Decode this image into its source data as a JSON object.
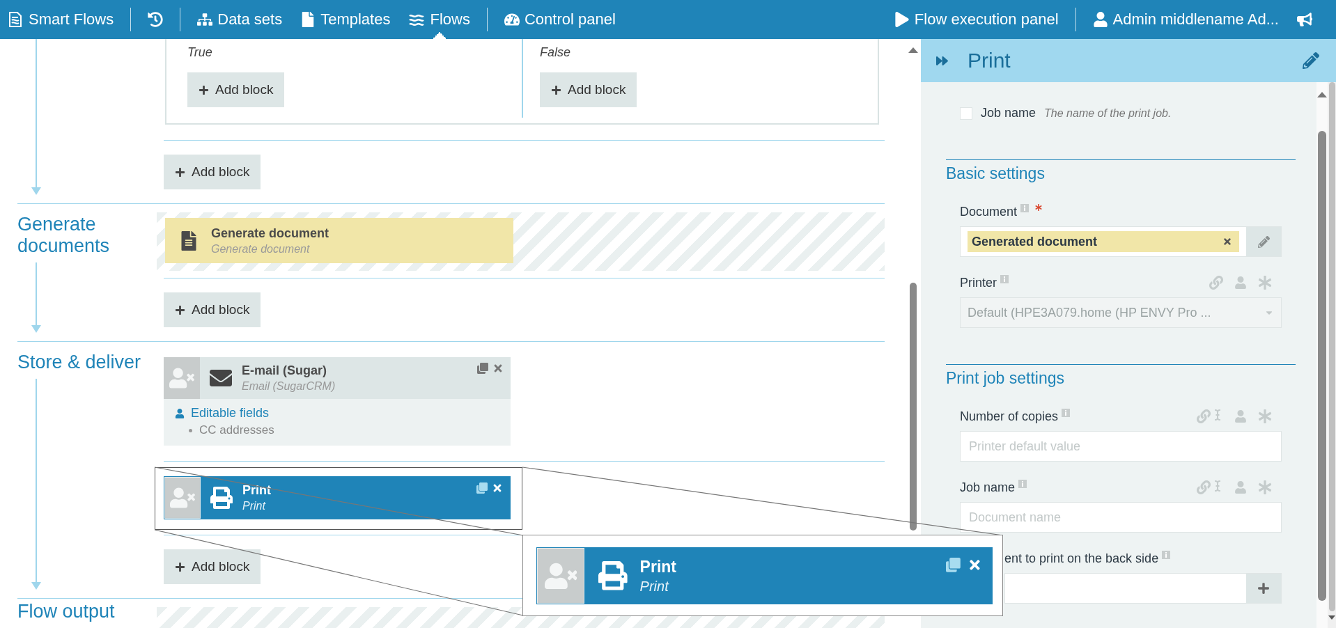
{
  "nav": {
    "left": [
      [
        {
          "kind": "brand",
          "label": "Smart Flows"
        }
      ],
      [
        {
          "kind": "history"
        }
      ],
      [
        {
          "kind": "datasets",
          "label": "Data sets",
          "selected": false
        },
        {
          "kind": "templates",
          "label": "Templates",
          "selected": false
        },
        {
          "kind": "flows",
          "label": "Flows",
          "selected": true
        }
      ],
      [
        {
          "kind": "control",
          "label": "Control panel",
          "selected": false
        }
      ]
    ],
    "right": [
      [
        {
          "kind": "execution",
          "label": "Flow execution panel"
        }
      ],
      [
        {
          "kind": "user",
          "label": "Admin middlename Ad..."
        },
        {
          "kind": "announce"
        }
      ]
    ]
  },
  "flow": {
    "sections": [
      {
        "blocks": [
          {
            "kind": "condition",
            "branches": [
              {
                "label": "True",
                "add_label": "Add block"
              },
              {
                "label": "False",
                "add_label": "Add block"
              }
            ]
          }
        ],
        "add_label": "Add block",
        "dropzone": false
      },
      {
        "title": "Generate documents",
        "blocks": [
          {
            "kind": "generator",
            "title": "Generate document",
            "subtitle": "Generate document"
          }
        ],
        "add_label": "Add block",
        "dropzone": true
      },
      {
        "title": "Store & deliver",
        "blocks": [
          {
            "kind": "email",
            "title": "E-mail (Sugar)",
            "subtitle": "Email (SugarCRM)",
            "selected": false,
            "editable": {
              "label": "Editable fields",
              "fields": [
                "CC addresses"
              ]
            }
          },
          {
            "kind": "print",
            "title": "Print",
            "subtitle": "Print",
            "selected": true
          }
        ],
        "add_label": "Add block",
        "dropzone": false
      },
      {
        "title": "Flow output",
        "dropzone": true
      }
    ]
  },
  "magnifier": {
    "kind": "print",
    "title": "Print",
    "subtitle": "Print"
  },
  "panel": {
    "title": "Print",
    "options": [
      {
        "label": "Job name",
        "hint": "The name of the print job.",
        "checked": false
      }
    ],
    "sections": [
      {
        "title": "Basic settings",
        "fields": [
          {
            "kind": "tag",
            "label": "Document",
            "required": true,
            "disabled": false,
            "tag": "Generated document"
          },
          {
            "kind": "select",
            "label": "Printer",
            "required": false,
            "disabled": true,
            "value": "Default (HPE3A079.home (HP ENVY Pro ..."
          }
        ]
      },
      {
        "title": "Print job settings",
        "fields": [
          {
            "kind": "text",
            "label": "Number of copies",
            "required": false,
            "disabled": false,
            "placeholder": "Printer default value"
          },
          {
            "kind": "text",
            "label": "Job name",
            "required": false,
            "disabled": false,
            "placeholder": "Document name"
          },
          {
            "kind": "list",
            "label": "ent to print on the back side",
            "required": false,
            "disabled": false
          }
        ]
      }
    ]
  }
}
